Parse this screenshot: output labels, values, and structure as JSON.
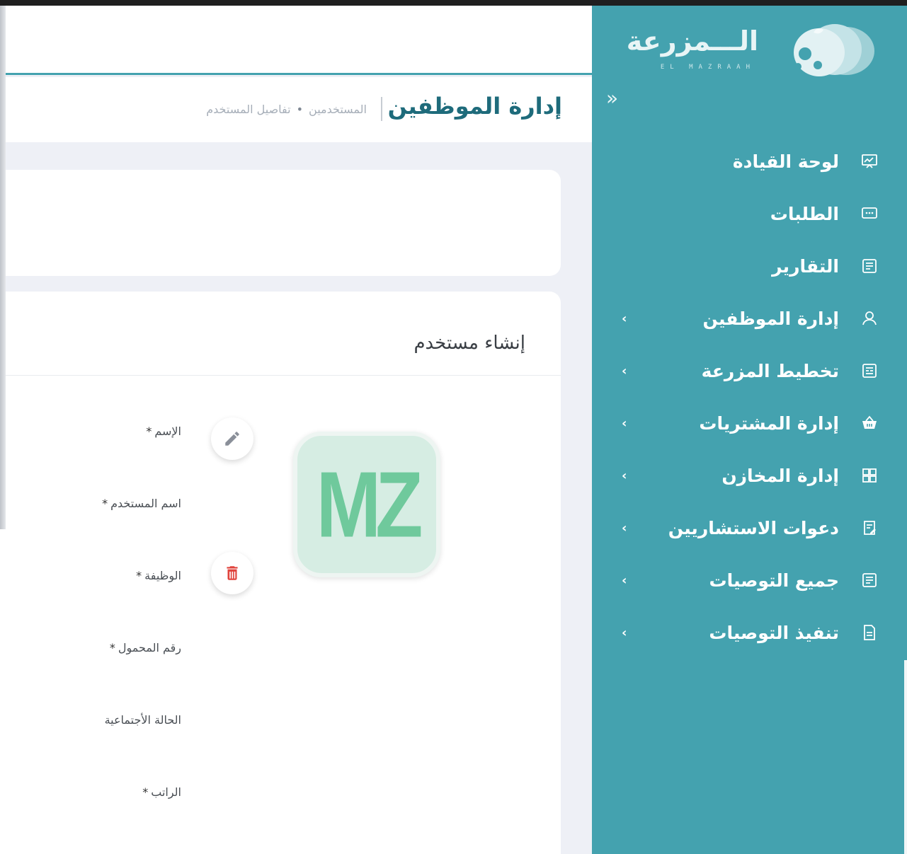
{
  "brand": {
    "name": "الـــمزرعة",
    "subtitle": "EL MAZRAAH"
  },
  "sidebar": {
    "collapse_glyph": "»",
    "items": [
      {
        "label": "لوحة القيادة",
        "icon": "dashboard-icon",
        "has_chevron": false
      },
      {
        "label": "الطلبات",
        "icon": "requests-icon",
        "has_chevron": false
      },
      {
        "label": "التقارير",
        "icon": "reports-icon",
        "has_chevron": false
      },
      {
        "label": "إدارة الموظفين",
        "icon": "users-icon",
        "has_chevron": true
      },
      {
        "label": "تخطيط المزرعة",
        "icon": "farm-plan-icon",
        "has_chevron": true
      },
      {
        "label": "إدارة المشتريات",
        "icon": "basket-icon",
        "has_chevron": true
      },
      {
        "label": "إدارة المخازن",
        "icon": "warehouse-grid-icon",
        "has_chevron": true
      },
      {
        "label": "دعوات الاستشاريين",
        "icon": "invitations-icon",
        "has_chevron": true
      },
      {
        "label": "جميع التوصيات",
        "icon": "recommendations-icon",
        "has_chevron": true
      },
      {
        "label": "تنفيذ التوصيات",
        "icon": "document-icon",
        "has_chevron": true
      }
    ],
    "chevron_glyph": "‹"
  },
  "header": {
    "page_title": "إدارة الموظفين",
    "breadcrumb": [
      "المستخدمين",
      "تفاصيل المستخدم"
    ],
    "breadcrumb_sep": "•"
  },
  "form": {
    "title": "إنشاء مستخدم",
    "avatar_initials": "MZ",
    "fields": [
      {
        "label": "الإسم",
        "required": true
      },
      {
        "label": "اسم المستخدم",
        "required": true
      },
      {
        "label": "الوظيفة",
        "required": true
      },
      {
        "label": "رقم المحمول",
        "required": true
      },
      {
        "label": "الحالة الأجتماعية",
        "required": false
      },
      {
        "label": "الراتب",
        "required": true
      }
    ],
    "required_mark": "*"
  },
  "colors": {
    "sidebar_bg": "#44a2af",
    "title": "#1e6b7b",
    "avatar_bg": "#d6ede3",
    "avatar_text": "#6fc99c",
    "delete": "#e0433c",
    "edit": "#8a8f99"
  }
}
